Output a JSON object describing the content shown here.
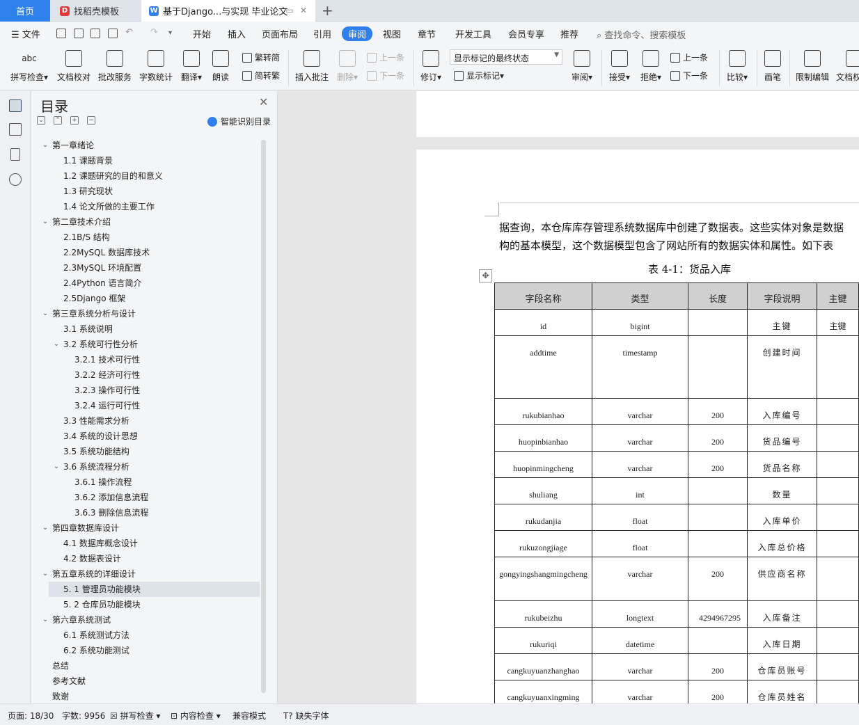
{
  "tabs": {
    "home": "首页",
    "template": "找稻壳模板",
    "document": "基于Django...与实现 毕业论文",
    "new_tab": "+"
  },
  "menu": {
    "file": "文件",
    "items": [
      "开始",
      "插入",
      "页面布局",
      "引用",
      "审阅",
      "视图",
      "章节",
      "开发工具",
      "会员专享",
      "推荐"
    ],
    "active": "审阅",
    "search": "查找命令、搜索模板"
  },
  "ribbon": {
    "spell_check": "拼写检查",
    "doc_proof": "文档校对",
    "batch_service": "批改服务",
    "word_count": "字数统计",
    "translate": "翻译",
    "read_aloud": "朗读",
    "trad_to_simp": "繁转简",
    "simp_to_trad": "简转繁",
    "insert_comment": "插入批注",
    "delete": "删除",
    "prev_comment": "上一条",
    "next_comment": "下一条",
    "revise": "修订",
    "markup_state": "显示标记的最终状态",
    "show_markup": "显示标记",
    "review": "审阅",
    "accept": "接受",
    "reject": "拒绝",
    "prev_change": "上一条",
    "next_change": "下一条",
    "compare": "比较",
    "pen": "画笔",
    "restrict_edit": "限制编辑",
    "doc_permission": "文档权"
  },
  "toc": {
    "title": "目录",
    "smart": "智能识别目录",
    "items": [
      {
        "label": "第一章绪论",
        "level": 1,
        "chevron": "open"
      },
      {
        "label": "1.1 课题背景",
        "level": 2
      },
      {
        "label": "1.2 课题研究的目的和意义",
        "level": 2
      },
      {
        "label": "1.3  研究现状",
        "level": 2
      },
      {
        "label": "1.4 论文所做的主要工作",
        "level": 2
      },
      {
        "label": "第二章技术介绍",
        "level": 1,
        "chevron": "open"
      },
      {
        "label": "2.1B/S 结构",
        "level": 2
      },
      {
        "label": "2.2MySQL 数据库技术",
        "level": 2
      },
      {
        "label": "2.3MySQL 环境配置",
        "level": 2
      },
      {
        "label": "2.4Python 语言简介",
        "level": 2
      },
      {
        "label": "2.5Django 框架",
        "level": 2
      },
      {
        "label": "第三章系统分析与设计",
        "level": 1,
        "chevron": "open"
      },
      {
        "label": "3.1 系统说明",
        "level": 2
      },
      {
        "label": "3.2 系统可行性分析",
        "level": 2,
        "chevron": "open"
      },
      {
        "label": "3.2.1  技术可行性",
        "level": 3
      },
      {
        "label": "3.2.2  经济可行性",
        "level": 3
      },
      {
        "label": "3.2.3 操作可行性",
        "level": 3
      },
      {
        "label": "3.2.4 运行可行性",
        "level": 3
      },
      {
        "label": "3.3  性能需求分析",
        "level": 2
      },
      {
        "label": "3.4 系统的设计思想",
        "level": 2
      },
      {
        "label": "3.5 系统功能结构",
        "level": 2
      },
      {
        "label": "3.6 系统流程分析",
        "level": 2,
        "chevron": "open"
      },
      {
        "label": "3.6.1 操作流程",
        "level": 3
      },
      {
        "label": "3.6.2 添加信息流程",
        "level": 3
      },
      {
        "label": "3.6.3 删除信息流程",
        "level": 3
      },
      {
        "label": "第四章数据库设计",
        "level": 1,
        "chevron": "open"
      },
      {
        "label": "4.1 数据库概念设计",
        "level": 2
      },
      {
        "label": "4.2 数据表设计",
        "level": 2
      },
      {
        "label": "第五章系统的详细设计",
        "level": 1,
        "chevron": "open"
      },
      {
        "label": "5. 1 管理员功能模块",
        "level": 2,
        "selected": true
      },
      {
        "label": "5. 2 仓库员功能模块",
        "level": 2
      },
      {
        "label": "第六章系统测试",
        "level": 1,
        "chevron": "open"
      },
      {
        "label": "6.1 系统测试方法",
        "level": 2
      },
      {
        "label": "6.2 系统功能测试",
        "level": 2
      },
      {
        "label": "总结",
        "level": 1
      },
      {
        "label": "参考文献",
        "level": 1
      },
      {
        "label": "致谢",
        "level": 1
      }
    ]
  },
  "document": {
    "line1": "据查询，本仓库库存管理系统数据库中创建了数据表。这些实体对象是数据",
    "line2": "构的基本模型，这个数据模型包含了网站所有的数据实体和属性。如下表",
    "table_caption": "表 4-1：货品入库",
    "table": {
      "headers": [
        "字段名称",
        "类型",
        "长度",
        "字段说明",
        "主键"
      ],
      "rows": [
        [
          "id",
          "bigint",
          "",
          "主键",
          "主键"
        ],
        [
          "addtime",
          "timestamp",
          "",
          "创建时间",
          ""
        ],
        [
          "rukubianhao",
          "varchar",
          "200",
          "入库编号",
          ""
        ],
        [
          "huopinbianhao",
          "varchar",
          "200",
          "货品编号",
          ""
        ],
        [
          "huopinmingcheng",
          "varchar",
          "200",
          "货品名称",
          ""
        ],
        [
          "shuliang",
          "int",
          "",
          "数量",
          ""
        ],
        [
          "rukudanjia",
          "float",
          "",
          "入库单价",
          ""
        ],
        [
          "rukuzongjiage",
          "float",
          "",
          "入库总价格",
          ""
        ],
        [
          "gongyingshangmingcheng",
          "varchar",
          "200",
          "供应商名称",
          ""
        ],
        [
          "rukubeizhu",
          "longtext",
          "4294967295",
          "入库备注",
          ""
        ],
        [
          "rukuriqi",
          "datetime",
          "",
          "入库日期",
          ""
        ],
        [
          "cangkuyuanzhanghao",
          "varchar",
          "200",
          "仓库员账号",
          ""
        ],
        [
          "cangkuyuanxingming",
          "varchar",
          "200",
          "仓库员姓名",
          ""
        ]
      ]
    }
  },
  "status": {
    "page": "页面: 18/30",
    "words": "字数: 9956",
    "spell": "拼写检查",
    "content": "内容检查",
    "compat": "兼容模式",
    "missing_font": "缺失字体"
  },
  "colors": {
    "accent": "#2f80ed",
    "table_header": "#d0d0d0"
  }
}
